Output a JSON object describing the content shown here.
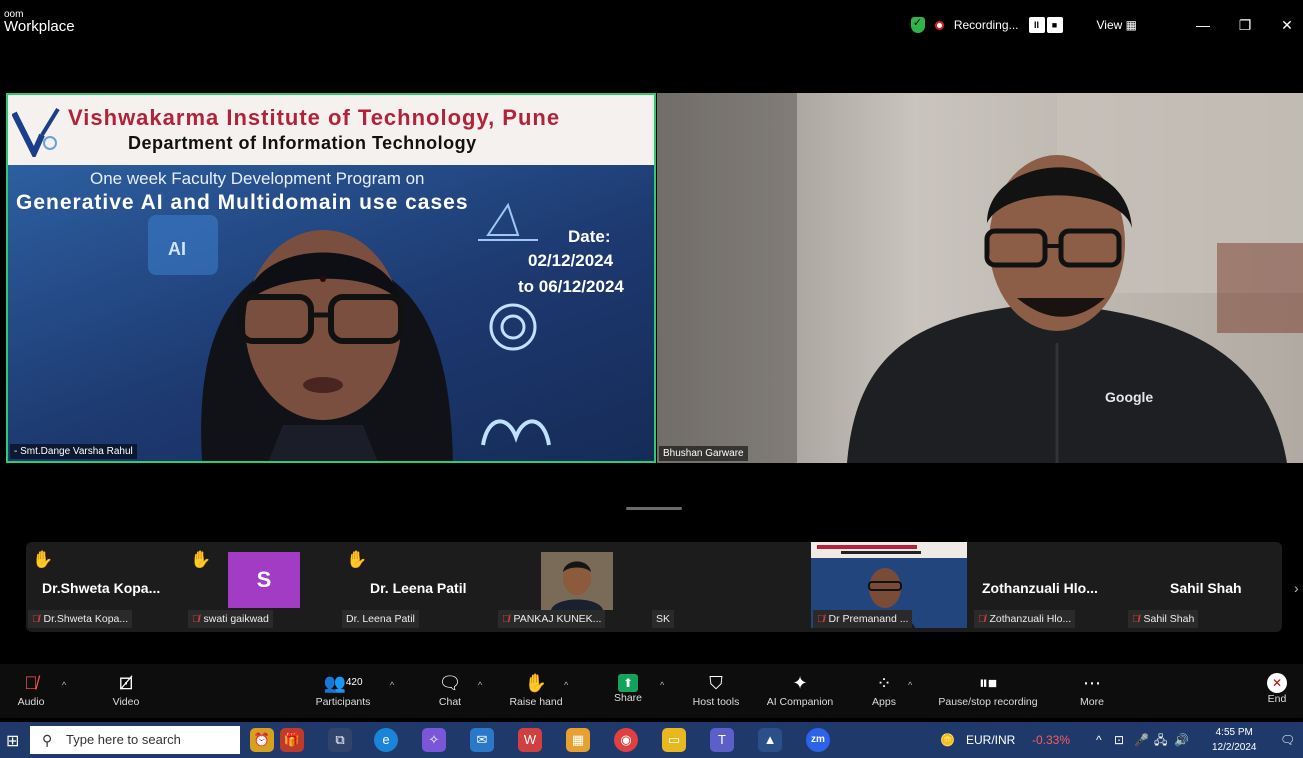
{
  "app": {
    "title_line1": "oom",
    "title_line2": "Workplace"
  },
  "titlebar": {
    "recording_label": "Recording...",
    "view_label": "View",
    "pause_icon": "II",
    "stop_icon": "■",
    "grid_icon": "▦",
    "minimize": "—",
    "restore": "❐",
    "close": "✕"
  },
  "slide": {
    "institute": "Vishwakarma Institute of Technology, Pune",
    "department": "Department of Information Technology",
    "program_line": "One week Faculty Development Program on",
    "topic_line": "Generative AI and Multidomain use cases",
    "date_label": "Date:",
    "date_from": "02/12/2024",
    "date_to": "to 06/12/2024"
  },
  "video": {
    "left_name": "- Smt.Dange Varsha Rahul",
    "right_name": "Bhushan Garware",
    "shirt_brand": "Google"
  },
  "participants": [
    {
      "big_name": "Dr.Shweta  Kopa...",
      "label": "Dr.Shweta Kopa...",
      "hand": "✋",
      "muted": true
    },
    {
      "big_name": "",
      "label": "swati gaikwad",
      "hand": "✋",
      "avatar_letter": "S",
      "muted": true
    },
    {
      "big_name": "Dr. Leena Patil",
      "label": "Dr. Leena Patil",
      "hand": "✋",
      "muted": false
    },
    {
      "big_name": "",
      "label": "PANKAJ KUNEK...",
      "muted": true
    },
    {
      "big_name": "",
      "label": "SK",
      "muted": false
    },
    {
      "big_name": "",
      "label": "Dr Premanand ...",
      "muted": true
    },
    {
      "big_name": "Zothanzuali  Hlo...",
      "label": "Zothanzuali Hlo...",
      "muted": true
    },
    {
      "big_name": "Sahil Shah",
      "label": "Sahil Shah",
      "muted": true
    }
  ],
  "toolbar": {
    "audio": "Audio",
    "video": "Video",
    "participants": "Participants",
    "participants_count": "420",
    "chat": "Chat",
    "raise_hand": "Raise hand",
    "share": "Share",
    "host_tools": "Host tools",
    "ai_companion": "AI Companion",
    "apps": "Apps",
    "pause_stop": "Pause/stop recording",
    "more": "More",
    "end": "End"
  },
  "taskbar": {
    "search_placeholder": "Type here to search",
    "currency_pair": "EUR/INR",
    "currency_change": "-0.33%",
    "time": "4:55 PM",
    "date": "12/2/2024",
    "zoom_icon_label": "zm"
  },
  "colors": {
    "active_speaker_border": "#2ecc71",
    "muted_red": "#e5413a",
    "share_green": "#13a35c",
    "avatar_purple": "#a33cc4"
  }
}
